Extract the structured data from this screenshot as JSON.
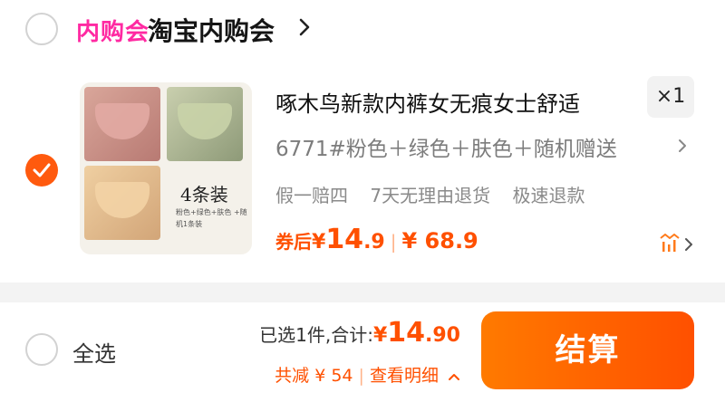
{
  "shop": {
    "badge": "内购会",
    "name": "淘宝内购会",
    "selected": false
  },
  "item": {
    "selected": true,
    "title": "啄木鸟新款内裤女无痕女士舒适",
    "quantity": "×1",
    "variant": "6771#粉色＋绿色＋肤色＋随机赠送",
    "services": [
      "假一赔四",
      "7天无理由退货",
      "极速退款"
    ],
    "coupon_label": "券后",
    "coupon_price_yen": "¥",
    "coupon_price_int": "14",
    "coupon_price_dec": ".9",
    "original_price": "¥ 68.9",
    "thumbnail": {
      "pack_title": "4条装",
      "pack_sub": "粉色+绿色+肤色 +随机1条装"
    }
  },
  "footer": {
    "select_all_label": "全选",
    "select_all_checked": false,
    "selected_count_text": "已选1件,",
    "total_label": "合计:",
    "total_yen": "¥",
    "total_int": "14",
    "total_dec": ".90",
    "savings_text": "共减 ¥ 54",
    "details_text": "查看明细",
    "checkout_label": "结算"
  },
  "colors": {
    "accent": "#ff5000",
    "badge": "#ff2aa2"
  },
  "icons": [
    "check-icon",
    "chevron-right-icon",
    "chevron-up-icon",
    "price-trend-icon"
  ]
}
